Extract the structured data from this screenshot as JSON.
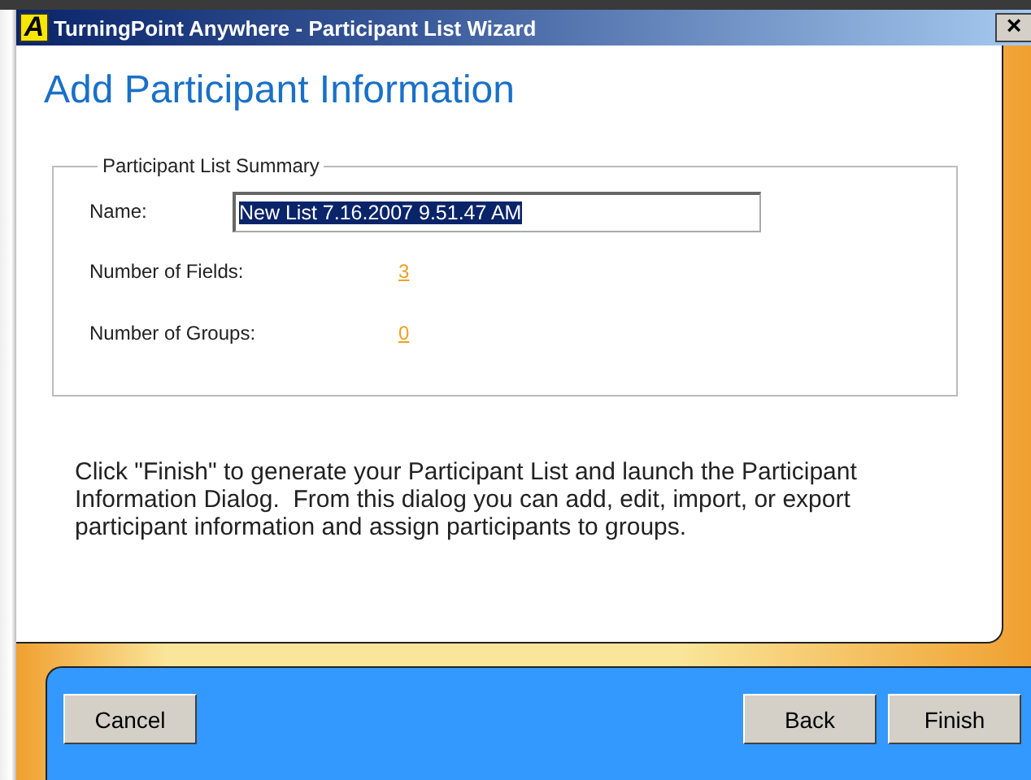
{
  "window": {
    "title": "TurningPoint Anywhere - Participant List Wizard",
    "logo": "A",
    "close": "×"
  },
  "heading": "Add Participant Information",
  "summary": {
    "legend": "Participant List Summary",
    "name_label": "Name:",
    "name_value": "New List 7.16.2007 9.51.47 AM",
    "name_selected": true,
    "fields_label": "Number of Fields:",
    "fields_value": "3",
    "groups_label": "Number of Groups:",
    "groups_value": "0"
  },
  "description": "Click \"Finish\" to generate your Participant List and launch the Participant Information Dialog.  From this dialog you can add, edit, import, or export participant information and assign participants to groups.",
  "left_buttons": [
    "Cancel"
  ],
  "right_buttons": [
    "Back",
    "Finish"
  ]
}
